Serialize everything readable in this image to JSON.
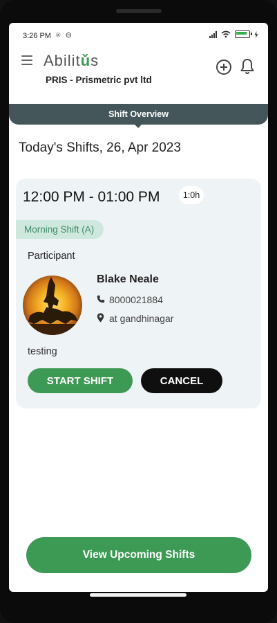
{
  "status_bar": {
    "time": "3:26 PM",
    "left_icons": "⍟ ⊖"
  },
  "header": {
    "logo": "Abilit",
    "logo_mark": "ǔ",
    "logo_tail": "s",
    "organization": "PRIS - Prismetric pvt ltd",
    "icons": [
      "menu-icon",
      "add-icon",
      "bell-icon"
    ]
  },
  "tab": {
    "label": "Shift Overview"
  },
  "today": {
    "title": "Today's Shifts, 26, Apr 2023"
  },
  "shift": {
    "time_range": "12:00 PM - 01:00 PM",
    "duration": "1:0h",
    "type": "Morning Shift (A)",
    "participant_label": "Participant",
    "participant": {
      "name": "Blake Neale",
      "phone": "8000021884",
      "location": "at gandhinagar"
    },
    "note": "testing",
    "start_label": "START SHIFT",
    "cancel_label": "CANCEL"
  },
  "footer": {
    "upcoming_label": "View Upcoming Shifts"
  },
  "colors": {
    "primary_green": "#3d9a55",
    "banner": "#44565a",
    "card_bg": "#eef3f5",
    "pill_bg": "#cfe8de",
    "pill_text": "#3d8a68"
  }
}
